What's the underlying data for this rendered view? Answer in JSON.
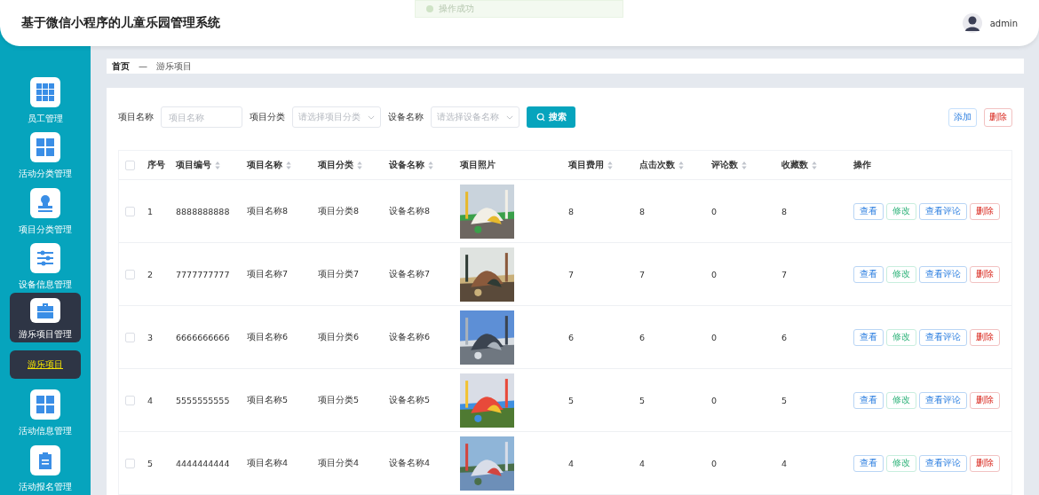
{
  "header": {
    "title": "基于微信小程序的儿童乐园管理系统",
    "user": "admin"
  },
  "toast": {
    "text": "操作成功"
  },
  "sidebar": {
    "items": [
      {
        "label": "员工管理",
        "selected": false
      },
      {
        "label": "活动分类管理",
        "selected": false
      },
      {
        "label": "项目分类管理",
        "selected": false
      },
      {
        "label": "设备信息管理",
        "selected": false
      },
      {
        "label": "游乐项目管理",
        "selected": true,
        "children": [
          {
            "label": "游乐项目",
            "selected": true
          }
        ]
      },
      {
        "label": "活动信息管理",
        "selected": false
      },
      {
        "label": "活动报名管理",
        "selected": false
      }
    ]
  },
  "breadcrumb": {
    "home": "首页",
    "separator": "—",
    "current": "游乐项目"
  },
  "filters": [
    {
      "kind": "input",
      "label": "项目名称",
      "placeholder": "项目名称"
    },
    {
      "kind": "select",
      "label": "项目分类",
      "placeholder": "请选择项目分类"
    },
    {
      "kind": "select",
      "label": "设备名称",
      "placeholder": "请选择设备名称"
    }
  ],
  "search_button": "搜索",
  "toolbar_buttons": [
    {
      "label": "添加",
      "kind": "primary"
    },
    {
      "label": "删除",
      "kind": "danger"
    }
  ],
  "table": {
    "select_all": {
      "checked": false
    },
    "columns": [
      {
        "label": "序号",
        "sortable": false
      },
      {
        "label": "项目编号",
        "sortable": true
      },
      {
        "label": "项目名称",
        "sortable": true
      },
      {
        "label": "项目分类",
        "sortable": true
      },
      {
        "label": "设备名称",
        "sortable": true
      },
      {
        "label": "项目照片",
        "sortable": false
      },
      {
        "label": "项目费用",
        "sortable": true
      },
      {
        "label": "点击次数",
        "sortable": true
      },
      {
        "label": "评论数",
        "sortable": true
      },
      {
        "label": "收藏数",
        "sortable": true
      },
      {
        "label": "操作",
        "sortable": false
      }
    ],
    "rows": [
      {
        "checked": false,
        "index": "1",
        "code": "8888888888",
        "name": "项目名称8",
        "category": "项目分类8",
        "device": "设备名称8",
        "photo": {
          "kind": "picture"
        },
        "fee": "8",
        "clicks": "8",
        "comments": "0",
        "favorites": "8",
        "actions": [
          {
            "label": "查看",
            "kind": "view"
          },
          {
            "label": "修改",
            "kind": "edit"
          },
          {
            "label": "查看评论",
            "kind": "view"
          },
          {
            "label": "删除",
            "kind": "delete"
          }
        ]
      },
      {
        "checked": false,
        "index": "2",
        "code": "7777777777",
        "name": "项目名称7",
        "category": "项目分类7",
        "device": "设备名称7",
        "photo": {
          "kind": "picture"
        },
        "fee": "7",
        "clicks": "7",
        "comments": "0",
        "favorites": "7",
        "actions": [
          {
            "label": "查看",
            "kind": "view"
          },
          {
            "label": "修改",
            "kind": "edit"
          },
          {
            "label": "查看评论",
            "kind": "view"
          },
          {
            "label": "删除",
            "kind": "delete"
          }
        ]
      },
      {
        "checked": false,
        "index": "3",
        "code": "6666666666",
        "name": "项目名称6",
        "category": "项目分类6",
        "device": "设备名称6",
        "photo": {
          "kind": "picture"
        },
        "fee": "6",
        "clicks": "6",
        "comments": "0",
        "favorites": "6",
        "actions": [
          {
            "label": "查看",
            "kind": "view"
          },
          {
            "label": "修改",
            "kind": "edit"
          },
          {
            "label": "查看评论",
            "kind": "view"
          },
          {
            "label": "删除",
            "kind": "delete"
          }
        ]
      },
      {
        "checked": false,
        "index": "4",
        "code": "5555555555",
        "name": "项目名称5",
        "category": "项目分类5",
        "device": "设备名称5",
        "photo": {
          "kind": "picture"
        },
        "fee": "5",
        "clicks": "5",
        "comments": "0",
        "favorites": "5",
        "actions": [
          {
            "label": "查看",
            "kind": "view"
          },
          {
            "label": "修改",
            "kind": "edit"
          },
          {
            "label": "查看评论",
            "kind": "view"
          },
          {
            "label": "删除",
            "kind": "delete"
          }
        ]
      },
      {
        "checked": false,
        "index": "5",
        "code": "4444444444",
        "name": "项目名称4",
        "category": "项目分类4",
        "device": "设备名称4",
        "photo": {
          "kind": "picture"
        },
        "fee": "4",
        "clicks": "4",
        "comments": "0",
        "favorites": "4",
        "actions": [
          {
            "label": "查看",
            "kind": "view"
          },
          {
            "label": "修改",
            "kind": "edit"
          },
          {
            "label": "查看评论",
            "kind": "view"
          },
          {
            "label": "删除",
            "kind": "delete"
          }
        ]
      }
    ]
  }
}
